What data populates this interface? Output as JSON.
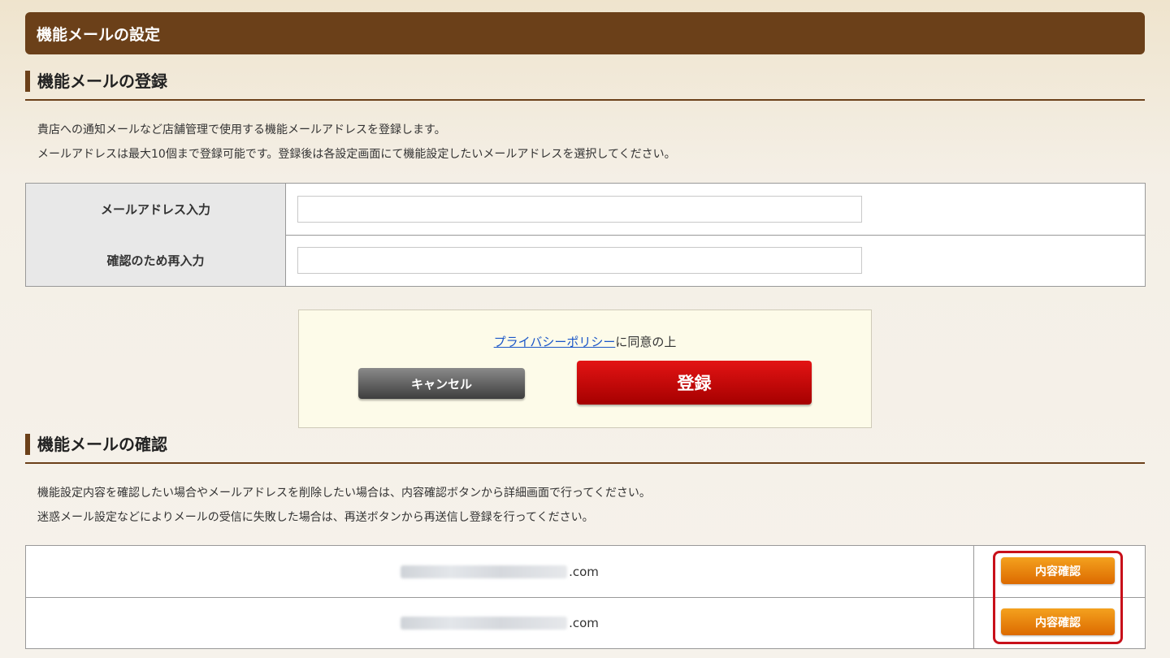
{
  "page_title": "機能メールの設定",
  "register_section": {
    "title": "機能メールの登録",
    "desc_lines": [
      "貴店への通知メールなど店舗管理で使用する機能メールアドレスを登録します。",
      "メールアドレスは最大10個まで登録可能です。登録後は各設定画面にて機能設定したいメールアドレスを選択してください。"
    ],
    "fields": [
      {
        "label": "メールアドレス入力",
        "value": ""
      },
      {
        "label": "確認のため再入力",
        "value": ""
      }
    ],
    "consent": {
      "link_text": "プライバシーポリシー",
      "suffix": "に同意の上"
    },
    "cancel_label": "キャンセル",
    "register_label": "登録"
  },
  "confirm_section": {
    "title": "機能メールの確認",
    "desc_lines": [
      "機能設定内容を確認したい場合やメールアドレスを削除したい場合は、内容確認ボタンから詳細画面で行ってください。",
      "迷惑メール設定などによりメールの受信に失敗した場合は、再送ボタンから再送信し登録を行ってください。"
    ],
    "emails": [
      {
        "visible_suffix": ".com",
        "button_label": "内容確認"
      },
      {
        "visible_suffix": ".com",
        "button_label": "内容確認"
      }
    ]
  },
  "colors": {
    "header_bg": "#6b4019",
    "register_red": "#d40b0b",
    "detail_orange": "#ea8510",
    "highlight_red": "#c8101a"
  }
}
